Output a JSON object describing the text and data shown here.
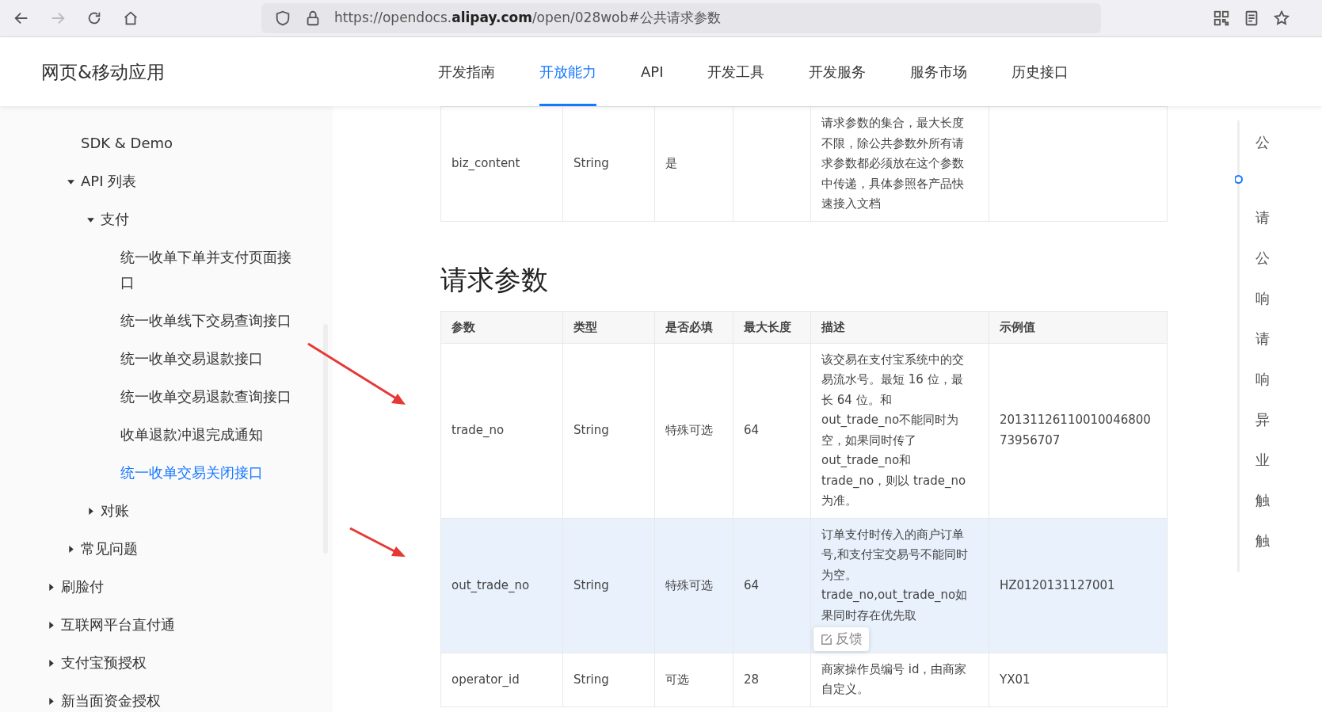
{
  "browser": {
    "url": "https://opendocs.**alipay.com**/open/028wob#公共请求参数",
    "forward_disabled": true
  },
  "header": {
    "title": "网页&移动应用",
    "tabs": [
      {
        "label": "开发指南",
        "selected": false
      },
      {
        "label": "开放能力",
        "selected": true
      },
      {
        "label": "API",
        "selected": false
      },
      {
        "label": "开发工具",
        "selected": false
      },
      {
        "label": "开发服务",
        "selected": false
      },
      {
        "label": "服务市场",
        "selected": false
      },
      {
        "label": "历史接口",
        "selected": false
      }
    ]
  },
  "sidebar": {
    "nested_items": [
      {
        "label": "SDK & Demo"
      },
      {
        "label": "API 列表",
        "expanded": true,
        "children": [
          {
            "label": "支付",
            "expanded": true,
            "children": [
              {
                "label": "统一收单下单并支付页面接口",
                "selected": false
              },
              {
                "label": "统一收单线下交易查询接口",
                "selected": false
              },
              {
                "label": "统一收单交易退款接口",
                "selected": false
              },
              {
                "label": "统一收单交易退款查询接口",
                "selected": false
              },
              {
                "label": "收单退款冲退完成通知",
                "selected": false
              },
              {
                "label": "统一收单交易关闭接口",
                "selected": true
              }
            ]
          },
          {
            "label": "对账",
            "expanded": false
          }
        ]
      },
      {
        "label": "常见问题",
        "expanded": false
      }
    ],
    "items": [
      {
        "label": "刷脸付",
        "expanded": false
      },
      {
        "label": "互联网平台直付通",
        "expanded": false
      },
      {
        "label": "支付宝预授权",
        "expanded": false
      },
      {
        "label": "新当面资金授权",
        "expanded": false
      }
    ]
  },
  "public_params_table": {
    "rows": [
      {
        "cells": [
          "biz_content",
          "String",
          "是",
          "",
          "请求参数的集合，最大长度不限，除公共参数外所有请求参数都必须放在这个参数中传递，具体参照各产品快速接入文档",
          ""
        ],
        "highlighted": false
      }
    ]
  },
  "section_title": "请求参数",
  "request_params_table": {
    "columns": [
      "参数",
      "类型",
      "是否必填",
      "最大长度",
      "描述",
      "示例值"
    ],
    "rows": [
      {
        "cells": [
          "trade_no",
          "String",
          "特殊可选",
          "64",
          "该交易在支付宝系统中的交易流水号。最短 16 位，最长 64 位。和 out_trade_no不能同时为空，如果同时传了 out_trade_no和 trade_no，则以 trade_no 为准。",
          "2013112611001004680073956707"
        ],
        "highlighted": false
      },
      {
        "cells": [
          "out_trade_no",
          "String",
          "特殊可选",
          "64",
          "订单支付时传入的商户订单号,和支付宝交易号不能同时为空。 trade_no,out_trade_no如果同时存在优先取",
          "HZ0120131127001"
        ],
        "highlighted": true
      },
      {
        "cells": [
          "operator_id",
          "String",
          "可选",
          "28",
          "商家操作员编号 id，由商家自定义。",
          "YX01"
        ],
        "highlighted": false
      }
    ]
  },
  "feedback_button": "反馈",
  "toc": {
    "items": [
      {
        "label": "公"
      },
      {
        "label": "请"
      },
      {
        "label": "公"
      },
      {
        "label": "响"
      },
      {
        "label": "请"
      },
      {
        "label": "响"
      },
      {
        "label": "异"
      },
      {
        "label": "业"
      },
      {
        "label": "触"
      },
      {
        "label": "触"
      }
    ]
  }
}
